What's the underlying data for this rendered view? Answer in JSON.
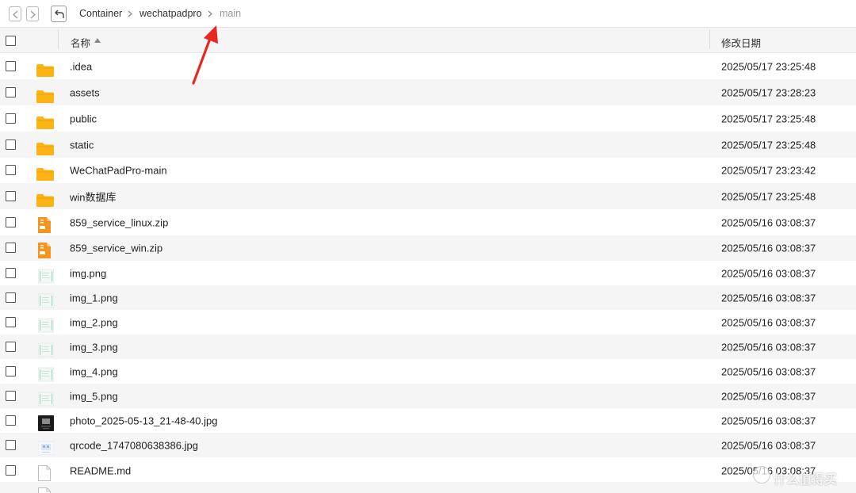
{
  "breadcrumb": [
    "Container",
    "wechatpadpro",
    "main"
  ],
  "columns": {
    "name": "名称",
    "modified": "修改日期"
  },
  "files": [
    {
      "name": ".idea",
      "date": "2025/05/17 23:25:48",
      "icon": "folder-icon"
    },
    {
      "name": "assets",
      "date": "2025/05/17 23:28:23",
      "icon": "folder-icon"
    },
    {
      "name": "public",
      "date": "2025/05/17 23:25:48",
      "icon": "folder-icon"
    },
    {
      "name": "static",
      "date": "2025/05/17 23:25:48",
      "icon": "folder-icon"
    },
    {
      "name": "WeChatPadPro-main",
      "date": "2025/05/17 23:23:42",
      "icon": "folder-icon"
    },
    {
      "name": "win数据库",
      "date": "2025/05/17 23:25:48",
      "icon": "folder-icon"
    },
    {
      "name": "859_service_linux.zip",
      "date": "2025/05/16 03:08:37",
      "icon": "zip-file-icon"
    },
    {
      "name": "859_service_win.zip",
      "date": "2025/05/16 03:08:37",
      "icon": "zip-file-icon"
    },
    {
      "name": "img.png",
      "date": "2025/05/16 03:08:37",
      "icon": "image-thumbnail-icon"
    },
    {
      "name": "img_1.png",
      "date": "2025/05/16 03:08:37",
      "icon": "image-thumbnail-icon"
    },
    {
      "name": "img_2.png",
      "date": "2025/05/16 03:08:37",
      "icon": "image-thumbnail-icon"
    },
    {
      "name": "img_3.png",
      "date": "2025/05/16 03:08:37",
      "icon": "image-thumbnail-icon"
    },
    {
      "name": "img_4.png",
      "date": "2025/05/16 03:08:37",
      "icon": "image-thumbnail-icon"
    },
    {
      "name": "img_5.png",
      "date": "2025/05/16 03:08:37",
      "icon": "image-thumbnail-icon"
    },
    {
      "name": "photo_2025-05-13_21-48-40.jpg",
      "date": "2025/05/16 03:08:37",
      "icon": "photo-thumbnail-icon"
    },
    {
      "name": "qrcode_1747080638386.jpg",
      "date": "2025/05/16 03:08:37",
      "icon": "qrcode-thumbnail-icon"
    },
    {
      "name": "README.md",
      "date": "2025/05/16 03:08:37",
      "icon": "document-icon"
    }
  ],
  "watermark": "什么值得买",
  "colors": {
    "folder": "#fcb414",
    "zip": "#f7941d",
    "arrow": "#e8271f",
    "row_alt": "#f5f5f5"
  }
}
